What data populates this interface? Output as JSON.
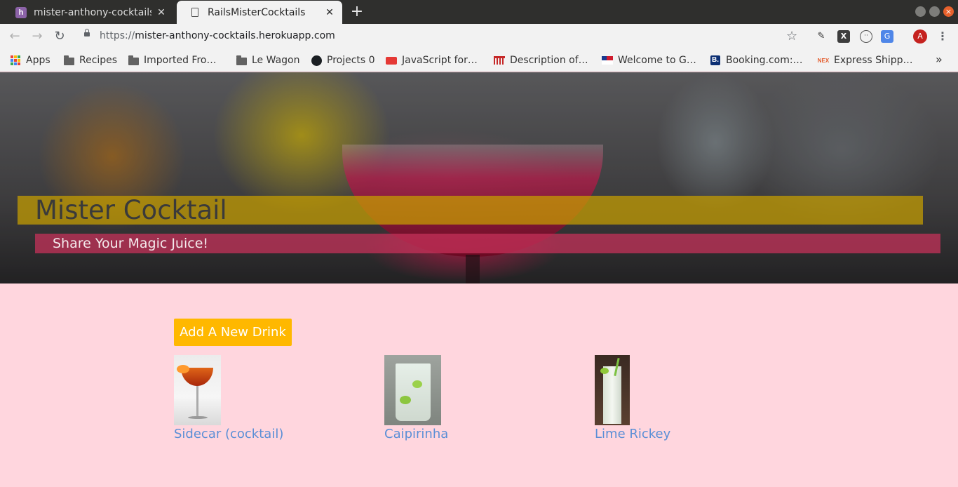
{
  "browser": {
    "tabs": [
      {
        "title": "mister-anthony-cocktails",
        "favicon": "heroku-icon",
        "active": false
      },
      {
        "title": "RailsMisterCocktails",
        "favicon": "document-icon",
        "active": true
      }
    ],
    "new_tab": "+",
    "url": {
      "scheme": "https://",
      "host": "mister-anthony-cocktails.herokuapp.com"
    },
    "profile_initial": "A",
    "bookmarks": [
      {
        "label": "Apps",
        "icon": "apps-grid-icon"
      },
      {
        "label": "Recipes",
        "icon": "folder-icon"
      },
      {
        "label": "Imported Fro…",
        "icon": "folder-icon"
      },
      {
        "label": "Le Wagon",
        "icon": "folder-icon"
      },
      {
        "label": "Projects 0",
        "icon": "github-icon"
      },
      {
        "label": "JavaScript for…",
        "icon": "bus-icon"
      },
      {
        "label": "Description of…",
        "icon": "railway-icon"
      },
      {
        "label": "Welcome to G…",
        "icon": "flag-icon"
      },
      {
        "label": "Booking.com:…",
        "icon": "booking-icon"
      },
      {
        "label": "Express Shipp…",
        "icon": "nex-icon"
      }
    ]
  },
  "hero": {
    "title": "Mister Cocktail",
    "subtitle": "Share Your Magic Juice!"
  },
  "actions": {
    "add_drink": "Add A New Drink"
  },
  "drinks": [
    {
      "name": "Sidecar (cocktail)",
      "thumbnail": "sidecar-photo"
    },
    {
      "name": "Caipirinha",
      "thumbnail": "caipirinha-photo"
    },
    {
      "name": "Lime Rickey",
      "thumbnail": "lime-rickey-photo"
    }
  ],
  "colors": {
    "page_background": "#ffd6de",
    "button": "#ffb800",
    "link": "#5b8fd6",
    "hero_title_band": "#c8a000",
    "hero_subtitle_band": "#c4325a"
  }
}
